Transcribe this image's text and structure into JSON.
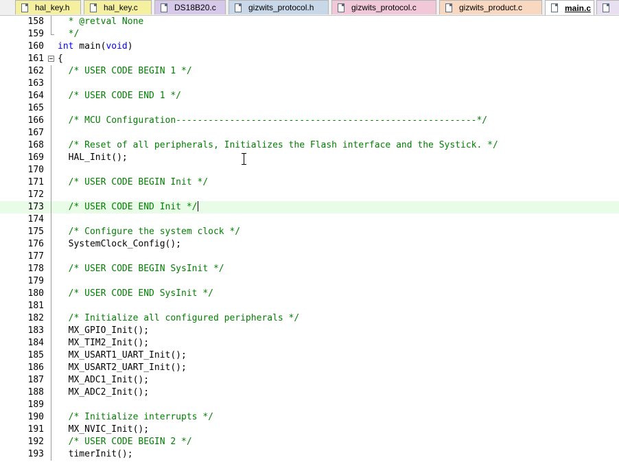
{
  "tabs": [
    {
      "label": "hal_key.h",
      "color": "#f5f0a0",
      "active": false
    },
    {
      "label": "hal_key.c",
      "color": "#f5f0a0",
      "active": false
    },
    {
      "label": "DS18B20.c",
      "color": "#d6c8e8",
      "active": false
    },
    {
      "label": "gizwits_protocol.h",
      "color": "#c8d8e8",
      "active": false
    },
    {
      "label": "gizwits_protocol.c",
      "color": "#f0c8d8",
      "active": false
    },
    {
      "label": "gizwits_product.c",
      "color": "#f8d8c0",
      "active": false
    },
    {
      "label": "main.c",
      "color": "#ffffff",
      "active": true
    }
  ],
  "editor": {
    "lines": [
      {
        "n": "158",
        "segs": [
          {
            "c": "cm",
            "t": "  * @retval None"
          }
        ]
      },
      {
        "n": "159",
        "segs": [
          {
            "c": "cm",
            "t": "  */"
          }
        ]
      },
      {
        "n": "160",
        "segs": [
          {
            "c": "kw",
            "t": "int"
          },
          {
            "c": "tx",
            "t": " main("
          },
          {
            "c": "kw",
            "t": "void"
          },
          {
            "c": "tx",
            "t": ")"
          }
        ]
      },
      {
        "n": "161",
        "segs": [
          {
            "c": "tx",
            "t": "{"
          }
        ]
      },
      {
        "n": "162",
        "segs": [
          {
            "c": "cm",
            "t": "  /* USER CODE BEGIN 1 */"
          }
        ]
      },
      {
        "n": "163",
        "segs": []
      },
      {
        "n": "164",
        "segs": [
          {
            "c": "cm",
            "t": "  /* USER CODE END 1 */"
          }
        ]
      },
      {
        "n": "165",
        "segs": []
      },
      {
        "n": "166",
        "segs": [
          {
            "c": "cm",
            "t": "  /* MCU Configuration--------------------------------------------------------*/"
          }
        ]
      },
      {
        "n": "167",
        "segs": []
      },
      {
        "n": "168",
        "segs": [
          {
            "c": "cm",
            "t": "  /* Reset of all peripherals, Initializes the Flash interface and the Systick. */"
          }
        ]
      },
      {
        "n": "169",
        "segs": [
          {
            "c": "tx",
            "t": "  HAL_Init();"
          }
        ]
      },
      {
        "n": "170",
        "segs": []
      },
      {
        "n": "171",
        "segs": [
          {
            "c": "cm",
            "t": "  /* USER CODE BEGIN Init */"
          }
        ]
      },
      {
        "n": "172",
        "segs": []
      },
      {
        "n": "173",
        "segs": [
          {
            "c": "cm",
            "t": "  /* USER CODE END Init */"
          }
        ]
      },
      {
        "n": "174",
        "segs": []
      },
      {
        "n": "175",
        "segs": [
          {
            "c": "cm",
            "t": "  /* Configure the system clock */"
          }
        ]
      },
      {
        "n": "176",
        "segs": [
          {
            "c": "tx",
            "t": "  SystemClock_Config();"
          }
        ]
      },
      {
        "n": "177",
        "segs": []
      },
      {
        "n": "178",
        "segs": [
          {
            "c": "cm",
            "t": "  /* USER CODE BEGIN SysInit */"
          }
        ]
      },
      {
        "n": "179",
        "segs": []
      },
      {
        "n": "180",
        "segs": [
          {
            "c": "cm",
            "t": "  /* USER CODE END SysInit */"
          }
        ]
      },
      {
        "n": "181",
        "segs": []
      },
      {
        "n": "182",
        "segs": [
          {
            "c": "cm",
            "t": "  /* Initialize all configured peripherals */"
          }
        ]
      },
      {
        "n": "183",
        "segs": [
          {
            "c": "tx",
            "t": "  MX_GPIO_Init();"
          }
        ]
      },
      {
        "n": "184",
        "segs": [
          {
            "c": "tx",
            "t": "  MX_TIM2_Init();"
          }
        ]
      },
      {
        "n": "185",
        "segs": [
          {
            "c": "tx",
            "t": "  MX_USART1_UART_Init();"
          }
        ]
      },
      {
        "n": "186",
        "segs": [
          {
            "c": "tx",
            "t": "  MX_USART2_UART_Init();"
          }
        ]
      },
      {
        "n": "187",
        "segs": [
          {
            "c": "tx",
            "t": "  MX_ADC1_Init();"
          }
        ]
      },
      {
        "n": "188",
        "segs": [
          {
            "c": "tx",
            "t": "  MX_ADC2_Init();"
          }
        ]
      },
      {
        "n": "189",
        "segs": []
      },
      {
        "n": "190",
        "segs": [
          {
            "c": "cm",
            "t": "  /* Initialize interrupts */"
          }
        ]
      },
      {
        "n": "191",
        "segs": [
          {
            "c": "tx",
            "t": "  MX_NVIC_Init();"
          }
        ]
      },
      {
        "n": "192",
        "segs": [
          {
            "c": "cm",
            "t": "  /* USER CODE BEGIN 2 */"
          }
        ]
      },
      {
        "n": "193",
        "segs": [
          {
            "c": "tx",
            "t": "  timerInit();"
          }
        ]
      }
    ],
    "current_line": "173",
    "current_line_color": "#e8fce8",
    "comment_color": "#008000",
    "keyword_color": "#0000ff"
  }
}
